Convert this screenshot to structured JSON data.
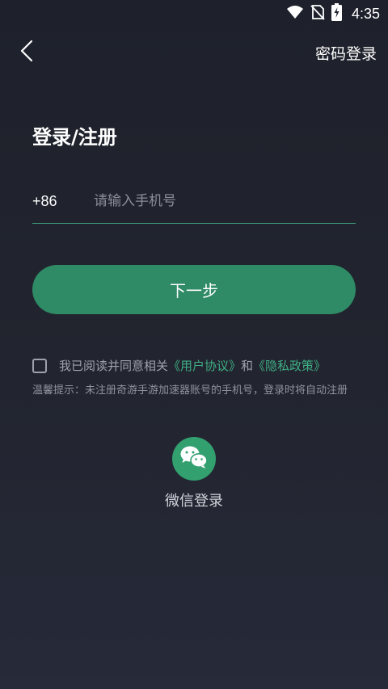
{
  "status_bar": {
    "time": "4:35",
    "icons": [
      "wifi-icon",
      "no-sim-icon",
      "battery-charging-icon"
    ]
  },
  "header": {
    "back_icon": "chevron-left-icon",
    "password_login_label": "密码登录"
  },
  "form": {
    "title": "登录/注册",
    "country_code": "+86",
    "phone_placeholder": "请输入手机号",
    "phone_value": "",
    "next_button_label": "下一步"
  },
  "agreement": {
    "checked": false,
    "prefix": "我已阅读并同意相关",
    "user_agreement_link": "《用户协议》",
    "conjunction": "和",
    "privacy_policy_link": "《隐私政策》"
  },
  "hint": "温馨提示：未注册奇游手游加速器账号的手机号，登录时将自动注册",
  "wechat": {
    "icon": "wechat-icon",
    "label": "微信登录"
  },
  "colors": {
    "accent": "#2f8a66",
    "link": "#3fae84",
    "background": "#1e212b"
  }
}
